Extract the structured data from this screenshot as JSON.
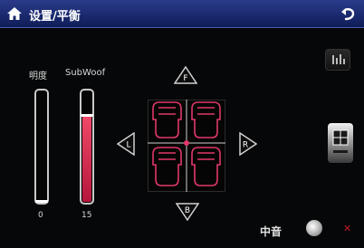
{
  "header": {
    "title": "设置/平衡",
    "home_icon": "home-icon",
    "back_icon": "back-arrow-icon"
  },
  "sliders": {
    "brightness": {
      "label": "明度",
      "value": "0",
      "level": 0.0
    },
    "subwoofer": {
      "label": "SubWoof",
      "value": "15",
      "level": 0.8
    }
  },
  "balance": {
    "front_label": "F",
    "rear_label": "B",
    "left_label": "L",
    "right_label": "R",
    "accent_color": "#e0386a"
  },
  "right_panel": {
    "eq_icon": "equalizer-icon",
    "grid_icon": "grid-icon"
  },
  "footer": {
    "center_label": "中音",
    "knob_icon": "disc-knob-icon",
    "close_icon": "close-icon"
  }
}
